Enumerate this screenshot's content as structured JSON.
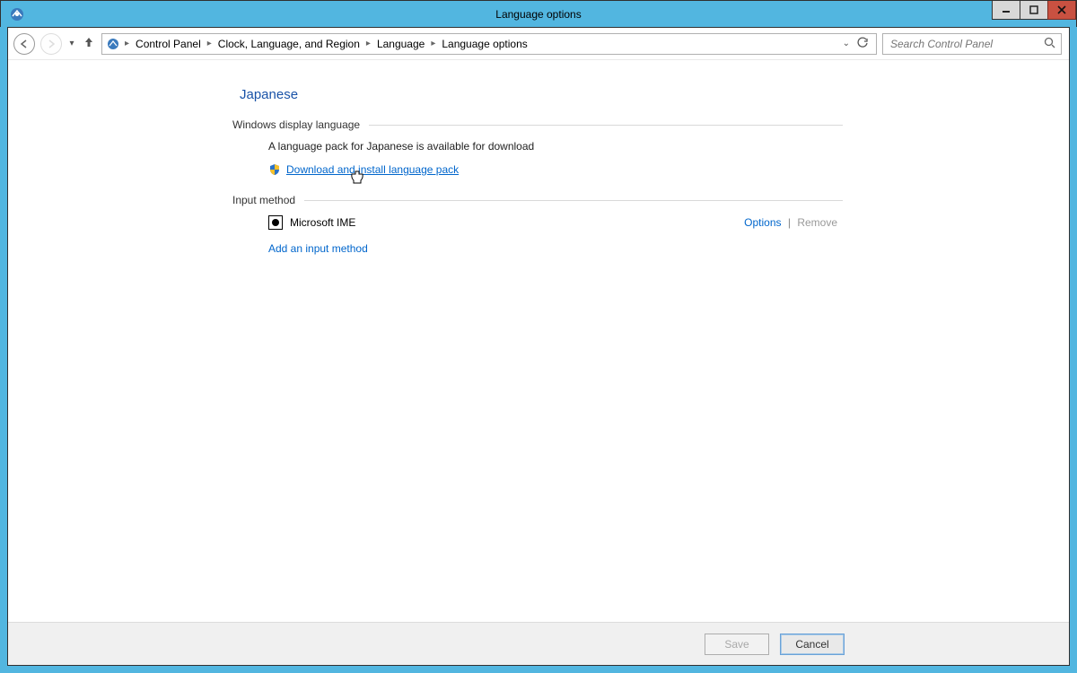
{
  "window": {
    "title": "Language options"
  },
  "breadcrumb": {
    "items": [
      "Control Panel",
      "Clock, Language, and Region",
      "Language",
      "Language options"
    ]
  },
  "search": {
    "placeholder": "Search Control Panel"
  },
  "page": {
    "heading": "Japanese"
  },
  "display_language": {
    "section_label": "Windows display language",
    "info": "A language pack for Japanese is available for download",
    "download_link": "Download and install language pack"
  },
  "input_method": {
    "section_label": "Input method",
    "ime_name": "Microsoft IME",
    "options_label": "Options",
    "remove_label": "Remove",
    "add_link": "Add an input method"
  },
  "buttons": {
    "save": "Save",
    "cancel": "Cancel"
  }
}
